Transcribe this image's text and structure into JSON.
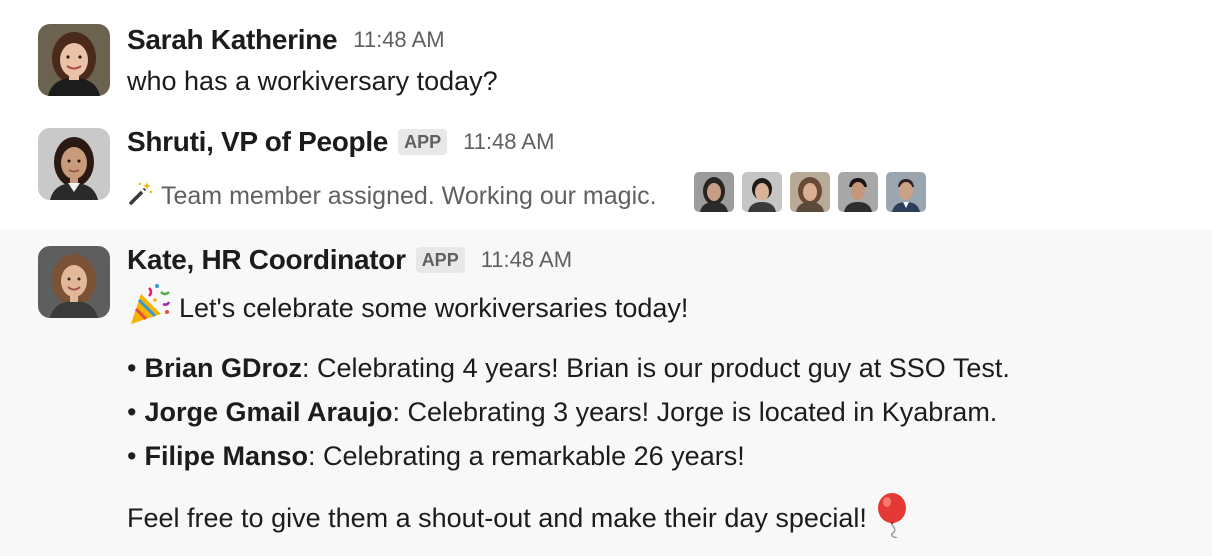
{
  "messages": [
    {
      "author": "Sarah Katherine",
      "time": "11:48 AM",
      "text": "who has a workiversary today?",
      "avatar_icon": "woman-portrait",
      "avatar_colors": {
        "bg": "#6b6250",
        "hair": "#4a2a1a",
        "skin": "#e9c2a8",
        "shirt": "#1c1c1c"
      }
    },
    {
      "author": "Shruti, VP of People",
      "app_badge": "APP",
      "time": "11:48 AM",
      "status_icon": "magic-wand-icon",
      "status_text": "Team member assigned. Working our magic.",
      "avatar_icon": "woman-portrait",
      "avatar_colors": {
        "bg": "#c9c9c9",
        "hair": "#2b1a14",
        "skin": "#c99a7c",
        "shirt": "#2a2a2a"
      },
      "assignees": [
        {
          "name": "assignee-1",
          "bg": "#9c9c9c",
          "hair": "#2a2420",
          "skin": "#c79f86",
          "shirt": "#2a2a2a"
        },
        {
          "name": "assignee-2",
          "bg": "#c5c5c5",
          "hair": "#1e1a18",
          "skin": "#d8b39a",
          "shirt": "#3a3a3a"
        },
        {
          "name": "assignee-3",
          "bg": "#b7aa96",
          "hair": "#6a4a34",
          "skin": "#d9b094",
          "shirt": "#5a4a3a"
        },
        {
          "name": "assignee-4",
          "bg": "#a8a8a8",
          "hair": "#1a1614",
          "skin": "#c4977a",
          "shirt": "#2e2e2e"
        },
        {
          "name": "assignee-5",
          "bg": "#9aa6b0",
          "hair": "#2a2220",
          "skin": "#caa185",
          "shirt": "#2c3e5a"
        }
      ]
    },
    {
      "author": "Kate, HR Coordinator",
      "app_badge": "APP",
      "time": "11:48 AM",
      "intro_icon": "party-popper-icon",
      "intro": "Let's celebrate some workiversaries today!",
      "avatar_icon": "woman-portrait",
      "avatar_colors": {
        "bg": "#5e5e5e",
        "hair": "#7a5236",
        "skin": "#e2b899",
        "shirt": "#3a3a3a"
      },
      "bullets": [
        {
          "name": "Brian GDroz",
          "text": ": Celebrating 4 years! Brian is our product guy at SSO Test."
        },
        {
          "name": "Jorge Gmail Araujo",
          "text": ": Celebrating 3 years! Jorge is located in Kyabram."
        },
        {
          "name": "Filipe Manso",
          "text": ": Celebrating a remarkable 26 years!"
        }
      ],
      "outro": "Feel free to give them a shout-out and make their day special!",
      "outro_icon": "balloon-icon"
    }
  ],
  "bullet_char": "•"
}
